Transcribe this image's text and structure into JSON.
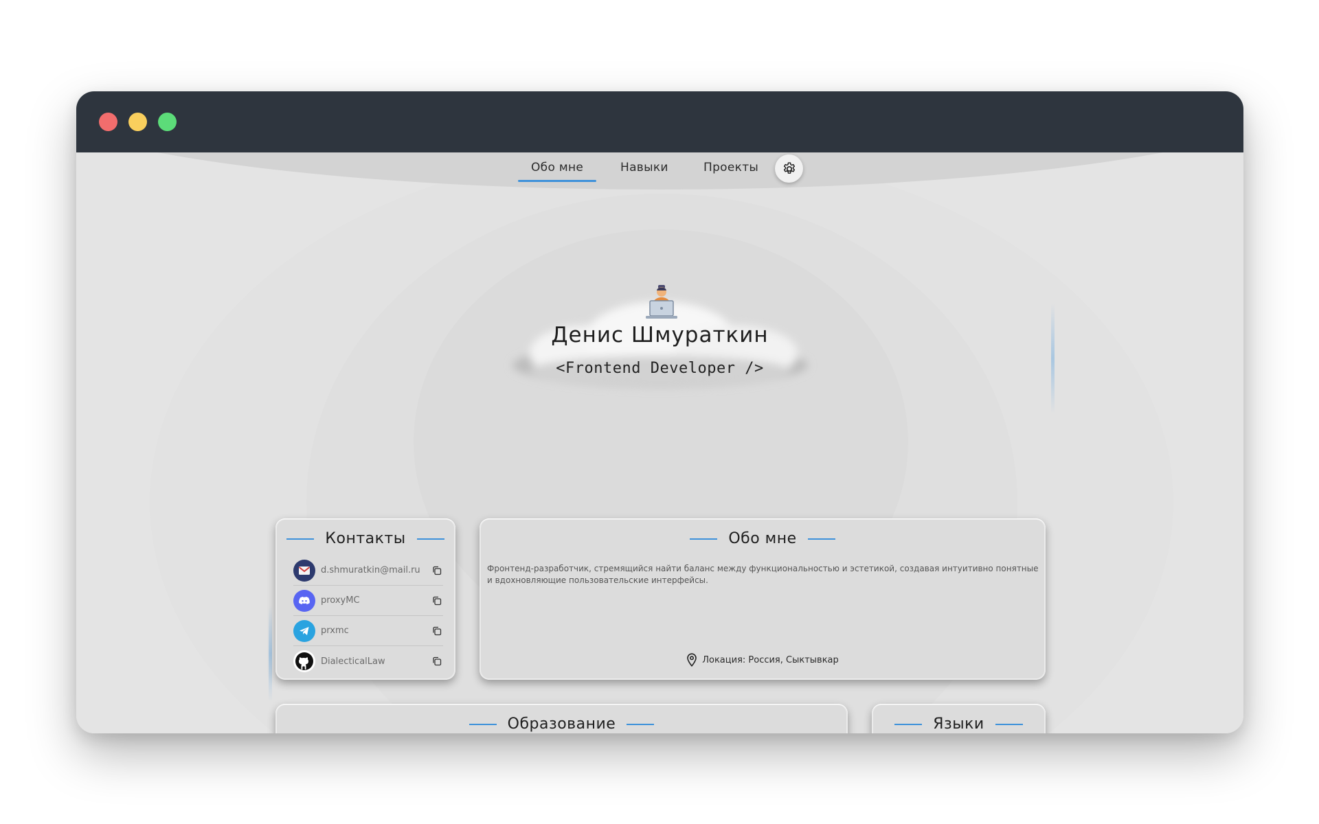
{
  "nav": {
    "items": [
      {
        "label": "Обо мне",
        "active": true
      },
      {
        "label": "Навыки",
        "active": false
      },
      {
        "label": "Проекты",
        "active": false
      }
    ],
    "settings_icon": "gear-icon"
  },
  "hero": {
    "avatar_icon": "developer-at-laptop-emoji",
    "name": "Денис Шмураткин",
    "role": "<Frontend Developer />"
  },
  "contacts": {
    "title": "Контакты",
    "items": [
      {
        "icon": "mail-icon",
        "value": "d.shmuratkin@mail.ru"
      },
      {
        "icon": "discord-icon",
        "value": "proxyMC"
      },
      {
        "icon": "telegram-icon",
        "value": "prxmc"
      },
      {
        "icon": "github-icon",
        "value": "DialecticalLaw"
      }
    ]
  },
  "about": {
    "title": "Обо мне",
    "text": "Фронтенд-разработчик, стремящийся найти баланс между функциональностью и эстетикой, создавая интуитивно понятные и вдохновляющие пользовательские интерфейсы.",
    "location": "Локация: Россия, Сыктывкар"
  },
  "education": {
    "title": "Образование"
  },
  "languages": {
    "title": "Языки"
  },
  "colors": {
    "accent": "#3d91da",
    "titlebar": "#2e353e",
    "background": "#e4e4e4",
    "close": "#f26d6d",
    "minimize": "#f9cf5d",
    "maximize": "#5cdc79"
  }
}
